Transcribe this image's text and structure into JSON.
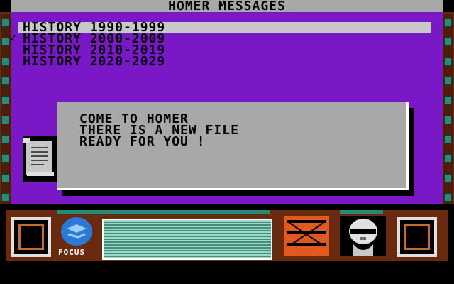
{
  "window": {
    "title": "HOMER MESSAGES"
  },
  "history_list": {
    "items": [
      {
        "label": "HISTORY 1990-1999",
        "selected": true,
        "checked": false
      },
      {
        "label": "HISTORY 2000-2009",
        "selected": false,
        "checked": true
      },
      {
        "label": "HISTORY 2010-2019",
        "selected": false,
        "checked": false
      },
      {
        "label": "HISTORY 2020-2029",
        "selected": false,
        "checked": false
      }
    ]
  },
  "message": {
    "line1": "COME TO HOMER",
    "line2": "THERE IS A NEW FILE",
    "line3": "READY FOR YOU !"
  },
  "toolbar": {
    "focus_label": "FOCUS"
  },
  "icons": {
    "scroll": "scroll-icon",
    "focus": "focus-icon",
    "red_gate": "gate-icon",
    "portrait": "portrait-icon"
  },
  "colors": {
    "background": "#7a18c8",
    "frame": "#6a2a10",
    "text_panel": "#a8a8a8",
    "accent": "#2a8a7a"
  }
}
